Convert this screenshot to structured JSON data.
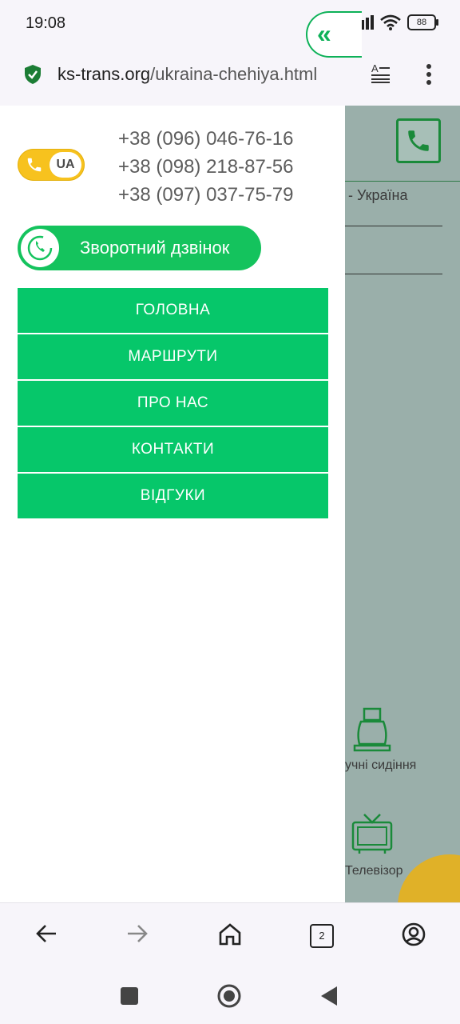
{
  "status": {
    "time": "19:08",
    "battery": "88"
  },
  "browser": {
    "url_host": "ks-trans.org",
    "url_path": "/ukraina-chehiya.html",
    "tab_count": "2"
  },
  "drawer": {
    "lang": "UA",
    "phones": [
      "+38 (096) 046-76-16",
      "+38 (098) 218-87-56",
      "+38 (097) 037-75-79"
    ],
    "collapse": "«",
    "callback_label": "Зворотний дзвінок",
    "menu": [
      "ГОЛОВНА",
      "МАРШРУТИ",
      "ПРО НАС",
      "КОНТАКТИ",
      "ВІДГУКИ"
    ]
  },
  "page": {
    "route_text": "- Україна",
    "seat_label": "учні сидіння",
    "tv_label": "Телевізор"
  },
  "colors": {
    "accent": "#06c76a",
    "toggle": "#f7c21e",
    "overlay": "#9aafaa"
  }
}
